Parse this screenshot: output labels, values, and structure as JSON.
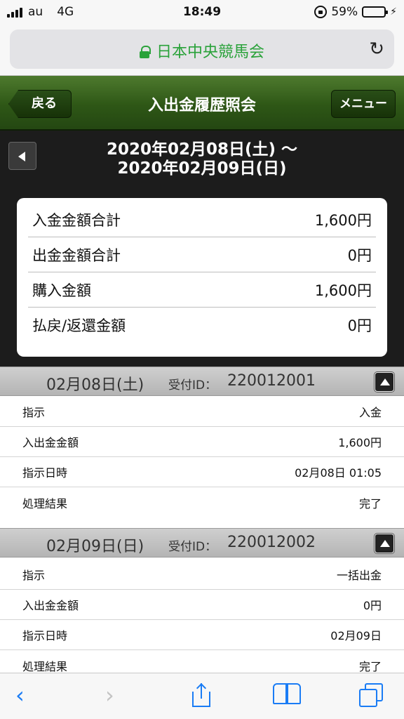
{
  "status_bar": {
    "carrier": "au",
    "network": "4G",
    "time": "18:49",
    "battery": "59%",
    "battery_level": 0.59
  },
  "browser": {
    "site_name": "日本中央競馬会",
    "reload_icon": "reload-icon"
  },
  "header": {
    "back_label": "戻る",
    "title": "入出金履歴照会",
    "menu_label": "メニュー"
  },
  "date_range": {
    "line1": "2020年02月08日(土) 〜",
    "line2": "2020年02月09日(日)"
  },
  "summary": [
    {
      "label": "入金金額合計",
      "value": "1,600円"
    },
    {
      "label": "出金金額合計",
      "value": "0円"
    },
    {
      "label": "購入金額",
      "value": "1,600円"
    },
    {
      "label": "払戻/返還金額",
      "value": "0円"
    }
  ],
  "transactions": [
    {
      "date": "02月08日(土)",
      "id_label": "受付ID：",
      "id": "220012001",
      "rows": [
        {
          "label": "指示",
          "value": "入金"
        },
        {
          "label": "入出金金額",
          "value": "1,600円"
        },
        {
          "label": "指示日時",
          "value": "02月08日 01:05"
        },
        {
          "label": "処理結果",
          "value": "完了"
        }
      ]
    },
    {
      "date": "02月09日(日)",
      "id_label": "受付ID：",
      "id": "220012002",
      "rows": [
        {
          "label": "指示",
          "value": "一括出金"
        },
        {
          "label": "入出金金額",
          "value": "0円"
        },
        {
          "label": "指示日時",
          "value": "02月09日"
        },
        {
          "label": "処理結果",
          "value": "完了"
        }
      ]
    }
  ],
  "colors": {
    "header_green": "#2e5716",
    "url_green": "#2aa23a",
    "ios_blue": "#1a7cf5"
  }
}
